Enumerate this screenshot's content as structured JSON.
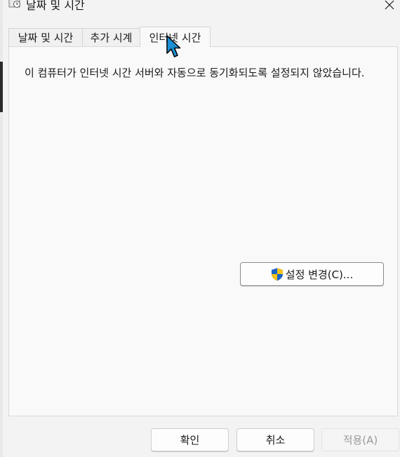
{
  "window": {
    "title": "날짜 및 시간"
  },
  "tabs": [
    {
      "label": "날짜 및 시간"
    },
    {
      "label": "추가 시계"
    },
    {
      "label": "인터넷 시간"
    }
  ],
  "internet_time": {
    "status_text": "이 컴퓨터가 인터넷 시간 서버와 자동으로 동기화되도록 설정되지 않았습니다.",
    "change_settings_label": "설정 변경(C)..."
  },
  "buttons": {
    "ok": "확인",
    "cancel": "취소",
    "apply": "적용(A)"
  },
  "icons": {
    "title": "calendar-clock-icon",
    "close": "close-icon",
    "shield": "uac-shield-icon",
    "cursor": "mouse-pointer-icon"
  },
  "colors": {
    "shield_blue": "#1a63c6",
    "shield_yellow": "#f3c21b",
    "cursor_fill": "#1c8fd6"
  }
}
